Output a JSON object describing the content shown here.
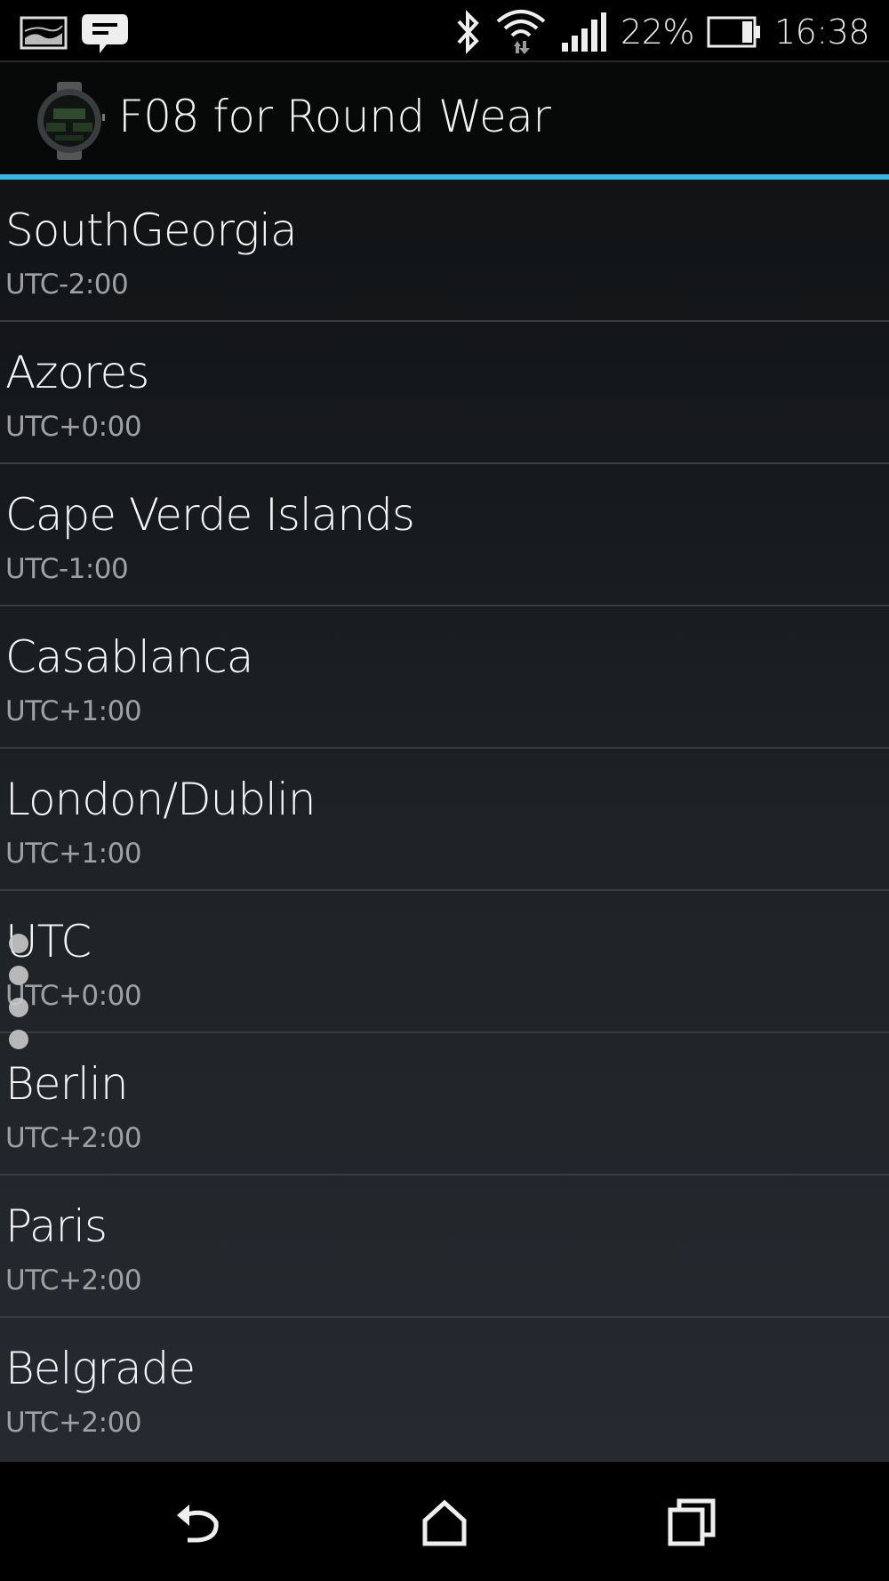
{
  "status_bar": {
    "left_icons": [
      "gallery-notification-icon",
      "messaging-notification-icon"
    ],
    "right_icons": [
      "bluetooth-icon",
      "wifi-icon",
      "signal-icon",
      "battery-icon"
    ],
    "battery_percent": "22%",
    "time": "16:38"
  },
  "action_bar": {
    "title": "F08 for Round Wear",
    "icon": "watch-face-app-icon"
  },
  "accent_color": "#33b5e5",
  "timezones": [
    {
      "name": "SouthGeorgia",
      "offset": "UTC-2:00"
    },
    {
      "name": "Azores",
      "offset": "UTC+0:00"
    },
    {
      "name": "Cape Verde Islands",
      "offset": "UTC-1:00"
    },
    {
      "name": "Casablanca",
      "offset": "UTC+1:00"
    },
    {
      "name": "London/Dublin",
      "offset": "UTC+1:00"
    },
    {
      "name": "UTC",
      "offset": "UTC+0:00"
    },
    {
      "name": "Berlin",
      "offset": "UTC+2:00"
    },
    {
      "name": "Paris",
      "offset": "UTC+2:00"
    },
    {
      "name": "Belgrade",
      "offset": "UTC+2:00"
    }
  ],
  "nav_bar": {
    "buttons": [
      "back-icon",
      "home-icon",
      "recent-apps-icon"
    ]
  }
}
